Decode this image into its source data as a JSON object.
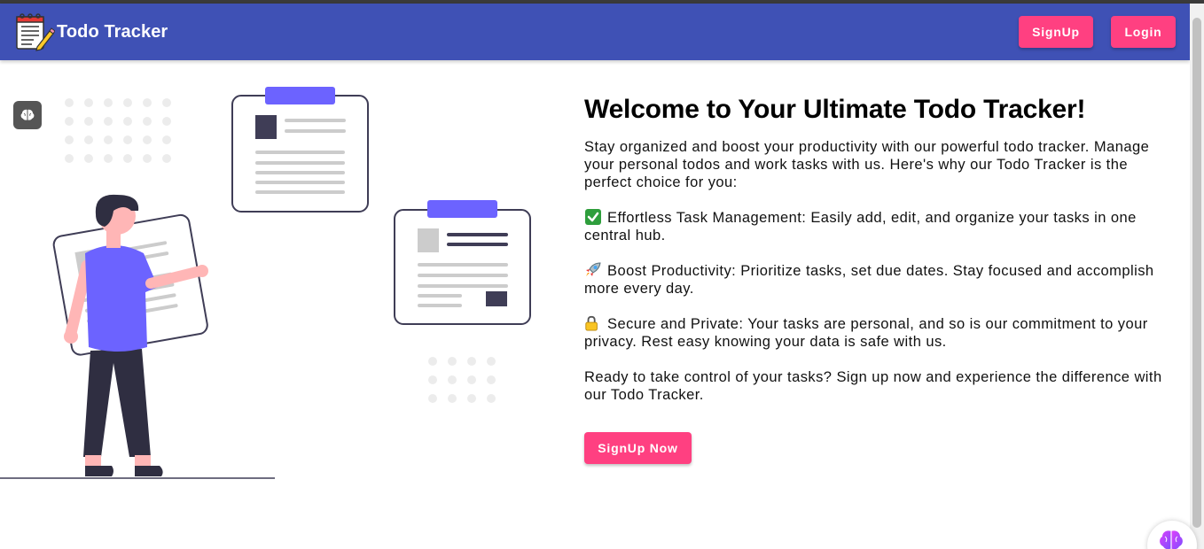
{
  "navbar": {
    "title": "Todo Tracker",
    "logo_icon": "notepad-pencil-icon",
    "signup_label": "SignUp",
    "login_label": "Login"
  },
  "hero": {
    "title": "Welcome to Your Ultimate Todo Tracker!",
    "intro": "Stay organized and boost your productivity with our powerful todo tracker. Manage your personal todos and work tasks with us. Here's why our Todo Tracker is the perfect choice for you:",
    "features": [
      {
        "icon": "check-mark-icon",
        "text": "Effortless Task Management: Easily add, edit, and organize your tasks in one central hub."
      },
      {
        "icon": "rocket-icon",
        "text": "Boost Productivity: Prioritize tasks, set due dates. Stay focused and accomplish more every day."
      },
      {
        "icon": "lock-icon",
        "text": "Secure and Private: Your tasks are personal, and so is our commitment to your privacy. Rest easy knowing your data is safe with us."
      }
    ],
    "outro": "Ready to take control of your tasks? Sign up now and experience the difference with our Todo Tracker.",
    "cta_label": "SignUp Now"
  },
  "colors": {
    "navbar_bg": "#3f51b5",
    "accent": "#ff4081",
    "illustration_accent": "#6c63ff"
  },
  "icons": {
    "side_tool": "brain-icon",
    "floating_assistant": "brain-icon"
  }
}
